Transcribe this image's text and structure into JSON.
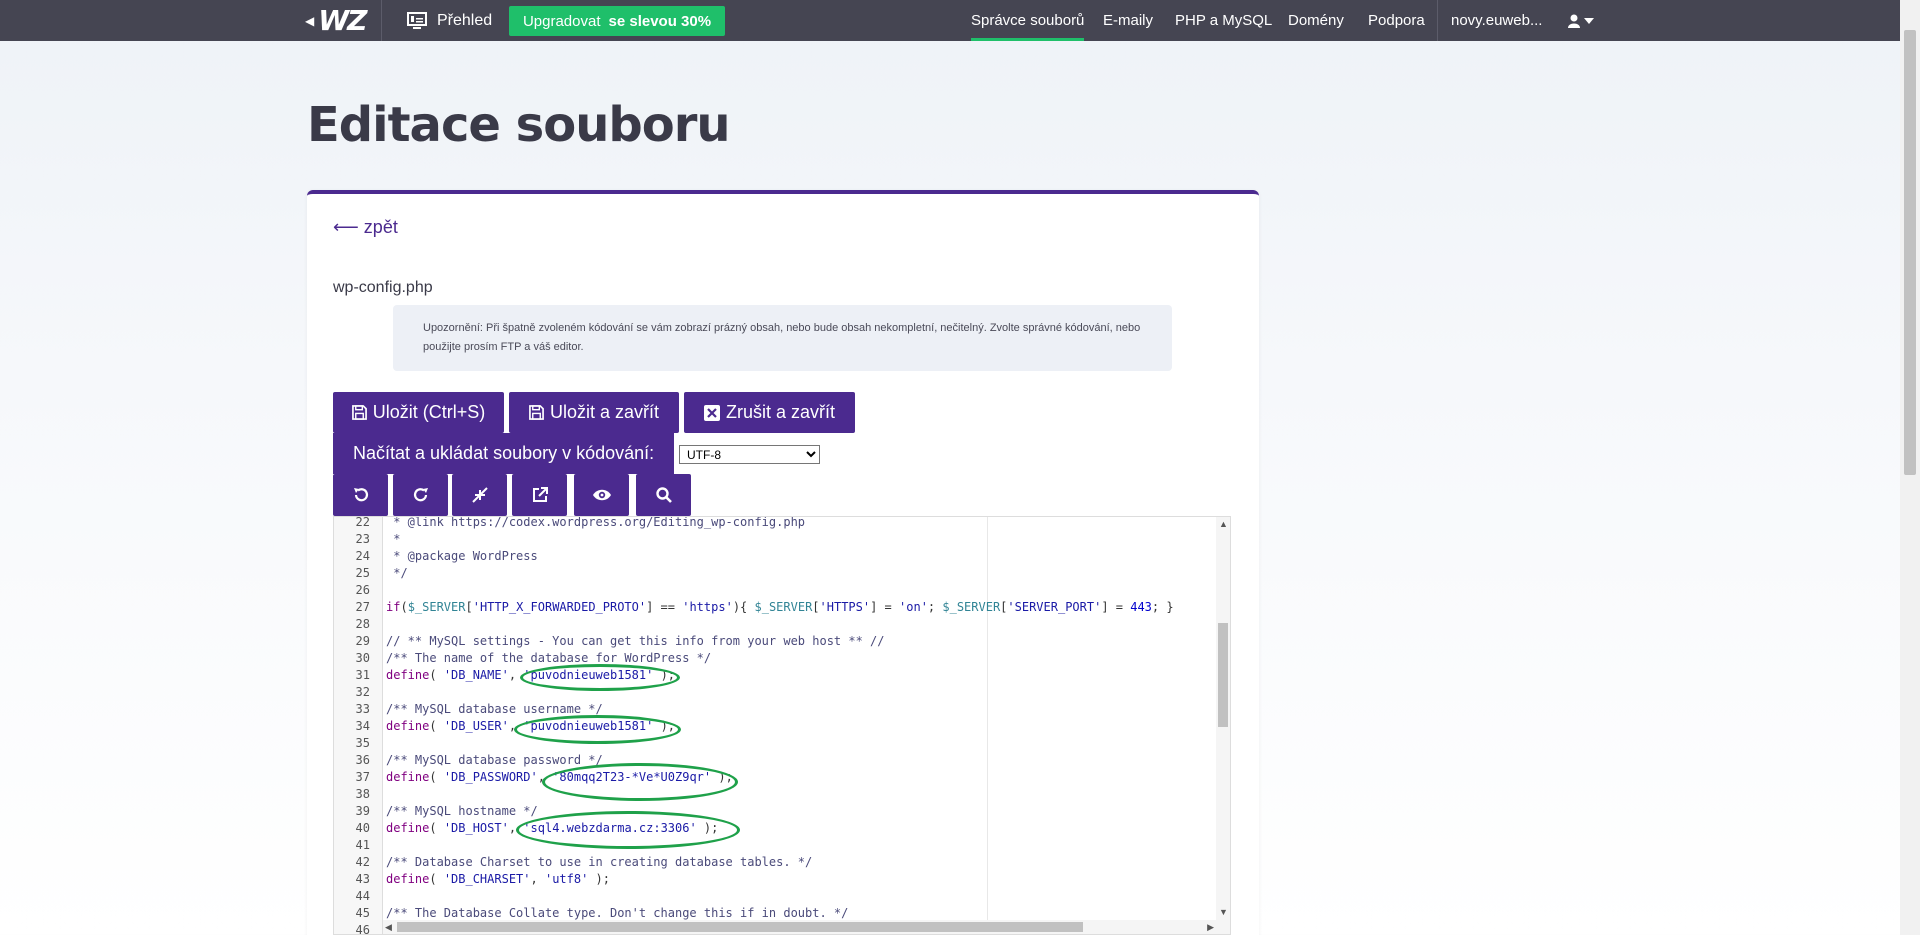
{
  "nav": {
    "logo": "WZ",
    "overview": "Přehled",
    "upgrade": "Upgradovat",
    "upgrade_discount": "se slevou 30%",
    "links": [
      "Správce souborů",
      "E-maily",
      "PHP a MySQL",
      "Domény",
      "Podpora",
      "novy.euweb..."
    ]
  },
  "page": {
    "title": "Editace souboru",
    "back": "⟵ zpět",
    "filename": "wp-config.php",
    "notice": "Upozornění: Při špatně zvoleném kódování se vám zobrazí prázný obsah, nebo bude obsah nekompletní, nečitelný. Zvolte správné kódování, nebo použijte prosím FTP a váš editor."
  },
  "buttons": {
    "save": "Uložit (Ctrl+S)",
    "save_close": "Uložit a zavřít",
    "cancel_close": "Zrušit a zavřít",
    "encoding_label": "Načítat a ukládat soubory v kódování:",
    "encoding_value": "UTF-8"
  },
  "editor": {
    "lines": [
      {
        "n": "22",
        "t": " * @link https://codex.wordpress.org/Editing_wp-config.php"
      },
      {
        "n": "23",
        "t": " *"
      },
      {
        "n": "24",
        "t": " * @package WordPress"
      },
      {
        "n": "25",
        "t": " */"
      },
      {
        "n": "26",
        "t": ""
      },
      {
        "n": "27",
        "t": "if($_SERVER['HTTP_X_FORWARDED_PROTO'] == 'https'){ $_SERVER['HTTPS'] = 'on'; $_SERVER['SERVER_PORT'] = 443; }"
      },
      {
        "n": "28",
        "t": ""
      },
      {
        "n": "29",
        "t": "// ** MySQL settings - You can get this info from your web host ** //"
      },
      {
        "n": "30",
        "t": "/** The name of the database for WordPress */"
      },
      {
        "n": "31",
        "t": "define( 'DB_NAME', 'puvodnieuweb1581' );"
      },
      {
        "n": "32",
        "t": ""
      },
      {
        "n": "33",
        "t": "/** MySQL database username */"
      },
      {
        "n": "34",
        "t": "define( 'DB_USER', 'puvodnieuweb1581' );"
      },
      {
        "n": "35",
        "t": ""
      },
      {
        "n": "36",
        "t": "/** MySQL database password */"
      },
      {
        "n": "37",
        "t": "define( 'DB_PASSWORD', '80mqq2T23-*Ve*U0Z9qr' );"
      },
      {
        "n": "38",
        "t": ""
      },
      {
        "n": "39",
        "t": "/** MySQL hostname */"
      },
      {
        "n": "40",
        "t": "define( 'DB_HOST', 'sql4.webzdarma.cz:3306' );"
      },
      {
        "n": "41",
        "t": ""
      },
      {
        "n": "42",
        "t": "/** Database Charset to use in creating database tables. */"
      },
      {
        "n": "43",
        "t": "define( 'DB_CHARSET', 'utf8' );"
      },
      {
        "n": "44",
        "t": ""
      },
      {
        "n": "45",
        "t": "/** The Database Collate type. Don't change this if in doubt. */"
      },
      {
        "n": "46",
        "t": ""
      }
    ]
  },
  "colors": {
    "topbar": "#454552",
    "accent": "#4b2a8f",
    "green": "#1fbf6a",
    "annotation": "#1fa14a"
  }
}
